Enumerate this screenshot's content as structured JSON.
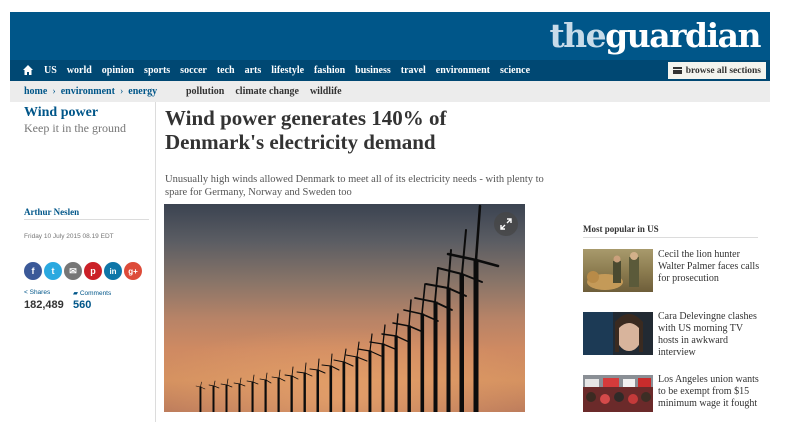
{
  "brand": {
    "logo_the": "the",
    "logo_guardian": "guardian",
    "color": "#005689"
  },
  "nav": {
    "items": [
      "US",
      "world",
      "opinion",
      "sports",
      "soccer",
      "tech",
      "arts",
      "lifestyle",
      "fashion",
      "business",
      "travel",
      "environment",
      "science"
    ],
    "browse_label": "browse all sections"
  },
  "subnav": {
    "breadcrumbs": [
      "home",
      "environment",
      "energy"
    ],
    "tags": [
      "pollution",
      "climate change",
      "wildlife"
    ]
  },
  "series": {
    "title": "Wind power",
    "subtitle": "Keep it in the ground"
  },
  "article": {
    "headline": "Wind power generates 140% of Denmark's electricity demand",
    "standfirst": "Unusually high winds allowed Denmark to meet all of its electricity needs - with plenty to spare for Germany, Norway and Sweden too",
    "byline": "Arthur Neslen",
    "dateline": "Friday 10 July 2015 08.19 EDT"
  },
  "share": {
    "buttons": [
      {
        "icon": "facebook-icon",
        "glyph": "f",
        "color": "#3b5998"
      },
      {
        "icon": "twitter-icon",
        "glyph": "t",
        "color": "#2aa9e0"
      },
      {
        "icon": "email-icon",
        "glyph": "✉",
        "color": "#767676"
      },
      {
        "icon": "pinterest-icon",
        "glyph": "p",
        "color": "#cb2027"
      },
      {
        "icon": "linkedin-icon",
        "glyph": "in",
        "color": "#0e76a8"
      },
      {
        "icon": "googleplus-icon",
        "glyph": "g+",
        "color": "#dd4b39"
      }
    ],
    "shares_label": "Shares",
    "shares_count": "182,489",
    "comments_label": "Comments",
    "comments_count": "560"
  },
  "most_popular": {
    "title": "Most popular in US",
    "items": [
      {
        "text": "Cecil the lion hunter Walter Palmer faces calls for prosecution"
      },
      {
        "text": "Cara Delevingne clashes with US morning TV hosts in awkward interview"
      },
      {
        "text": "Los Angeles union wants to be exempt from $15 minimum wage it fought"
      }
    ]
  }
}
